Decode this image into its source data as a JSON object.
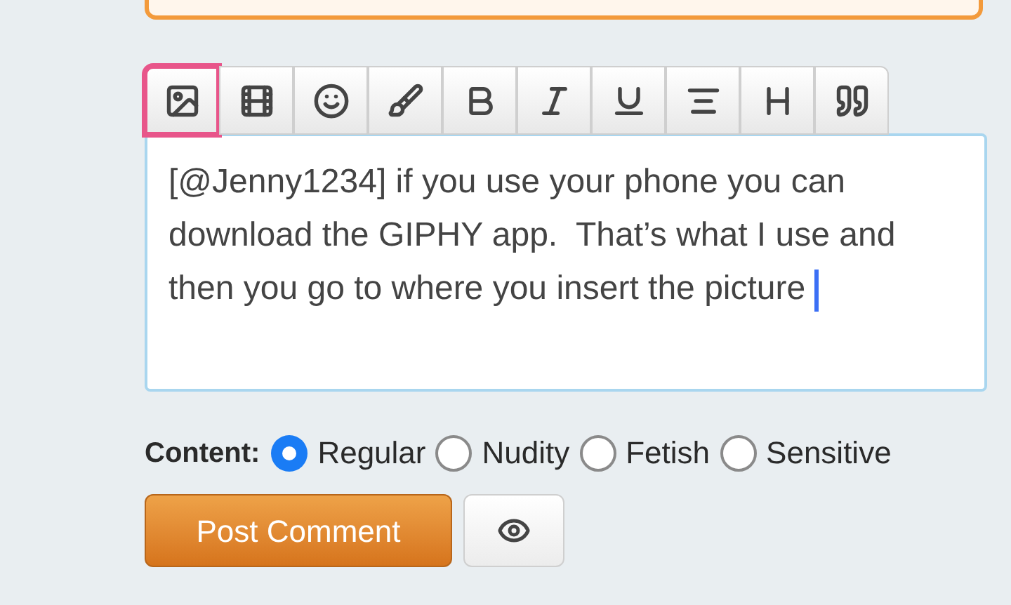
{
  "toolbar": [
    {
      "kind": "image",
      "highlighted": true
    },
    {
      "kind": "video",
      "highlighted": false
    },
    {
      "kind": "emoji",
      "highlighted": false
    },
    {
      "kind": "brush",
      "highlighted": false
    },
    {
      "kind": "bold",
      "highlighted": false
    },
    {
      "kind": "italic",
      "highlighted": false
    },
    {
      "kind": "underline",
      "highlighted": false
    },
    {
      "kind": "align",
      "highlighted": false
    },
    {
      "kind": "heading",
      "highlighted": false
    },
    {
      "kind": "quote",
      "highlighted": false
    }
  ],
  "comment": {
    "value": "[@Jenny1234] if you use your phone you can download the GIPHY app.  That’s what I use and then you go to where you insert the picture "
  },
  "content": {
    "label": "Content:",
    "options": [
      {
        "label": "Regular",
        "selected": true
      },
      {
        "label": "Nudity",
        "selected": false
      },
      {
        "label": "Fetish",
        "selected": false
      },
      {
        "label": "Sensitive",
        "selected": false
      }
    ]
  },
  "post_button": "Post Comment"
}
